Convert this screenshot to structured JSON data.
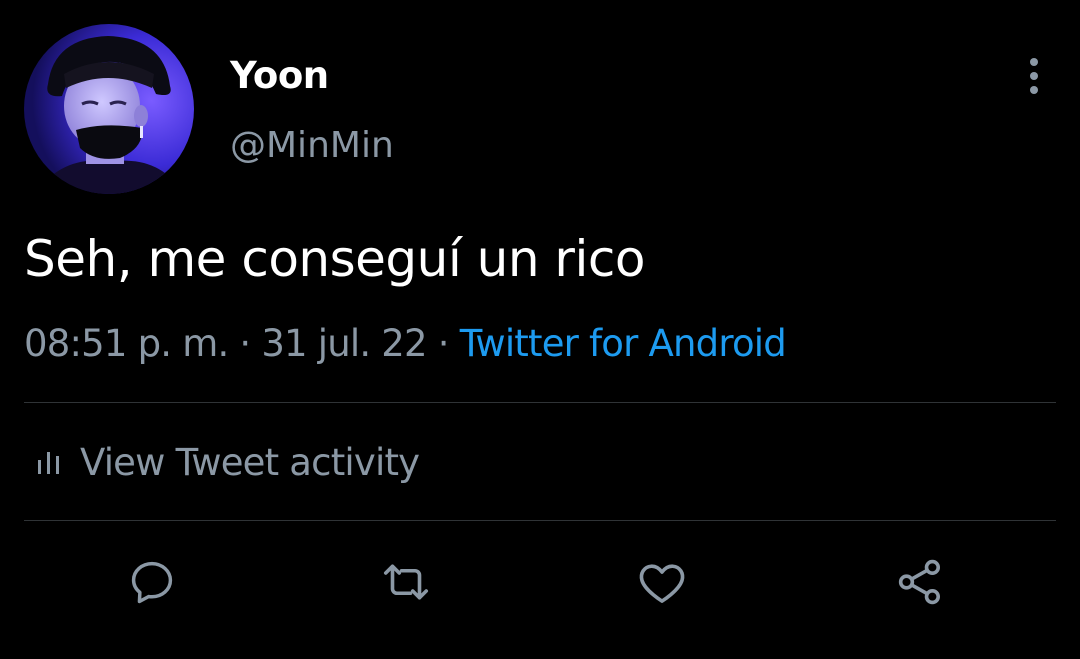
{
  "author": {
    "display_name": "Yoon",
    "handle": "@MinMin",
    "avatar": "avatar-photo"
  },
  "tweet": {
    "text": "Seh, me conseguí un rico",
    "time": "08:51 p. m.",
    "separator": "·",
    "date": "31 jul. 22",
    "source": "Twitter for Android"
  },
  "activity": {
    "icon": "bar-chart-icon",
    "label": "View Tweet activity"
  },
  "actions": [
    {
      "icon": "reply-icon"
    },
    {
      "icon": "retweet-icon"
    },
    {
      "icon": "like-icon"
    },
    {
      "icon": "share-icon"
    }
  ],
  "menu_icon": "more-vertical-icon",
  "colors": {
    "background": "#000000",
    "primary_text": "#ffffff",
    "secondary_text": "#8b98a5",
    "link": "#1d9bf0",
    "divider": "#2f3336"
  }
}
